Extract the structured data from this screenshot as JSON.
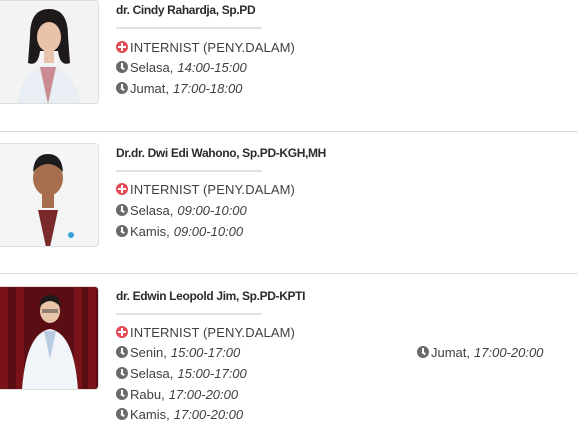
{
  "doctors": [
    {
      "name": "dr. Cindy Rahardja, Sp.PD",
      "specialty": "INTERNIST (PENY.DALAM)",
      "schedule": [
        {
          "day": "Selasa,",
          "time": "14:00-15:00"
        },
        {
          "day": "Jumat,",
          "time": "17:00-18:00"
        }
      ]
    },
    {
      "name": "Dr.dr. Dwi Edi Wahono, Sp.PD-KGH,MH",
      "specialty": "INTERNIST (PENY.DALAM)",
      "schedule": [
        {
          "day": "Selasa,",
          "time": "09:00-10:00"
        },
        {
          "day": "Kamis,",
          "time": "09:00-10:00"
        }
      ]
    },
    {
      "name": "dr. Edwin Leopold Jim, Sp.PD-KPTI",
      "specialty": "INTERNIST (PENY.DALAM)",
      "schedule": [
        {
          "day": "Senin,",
          "time": "15:00-17:00"
        },
        {
          "day": "Jumat,",
          "time": "17:00-20:00"
        },
        {
          "day": "Selasa,",
          "time": "15:00-17:00"
        },
        {
          "day": "Rabu,",
          "time": "17:00-20:00"
        },
        {
          "day": "Kamis,",
          "time": "17:00-20:00"
        }
      ]
    }
  ],
  "icons": {
    "specialty": "medical-cross-icon",
    "schedule": "clock-icon"
  },
  "colors": {
    "specialty_icon": "#e34a52",
    "clock_icon": "#6a6a6a",
    "separator": "#dcdcdc"
  }
}
